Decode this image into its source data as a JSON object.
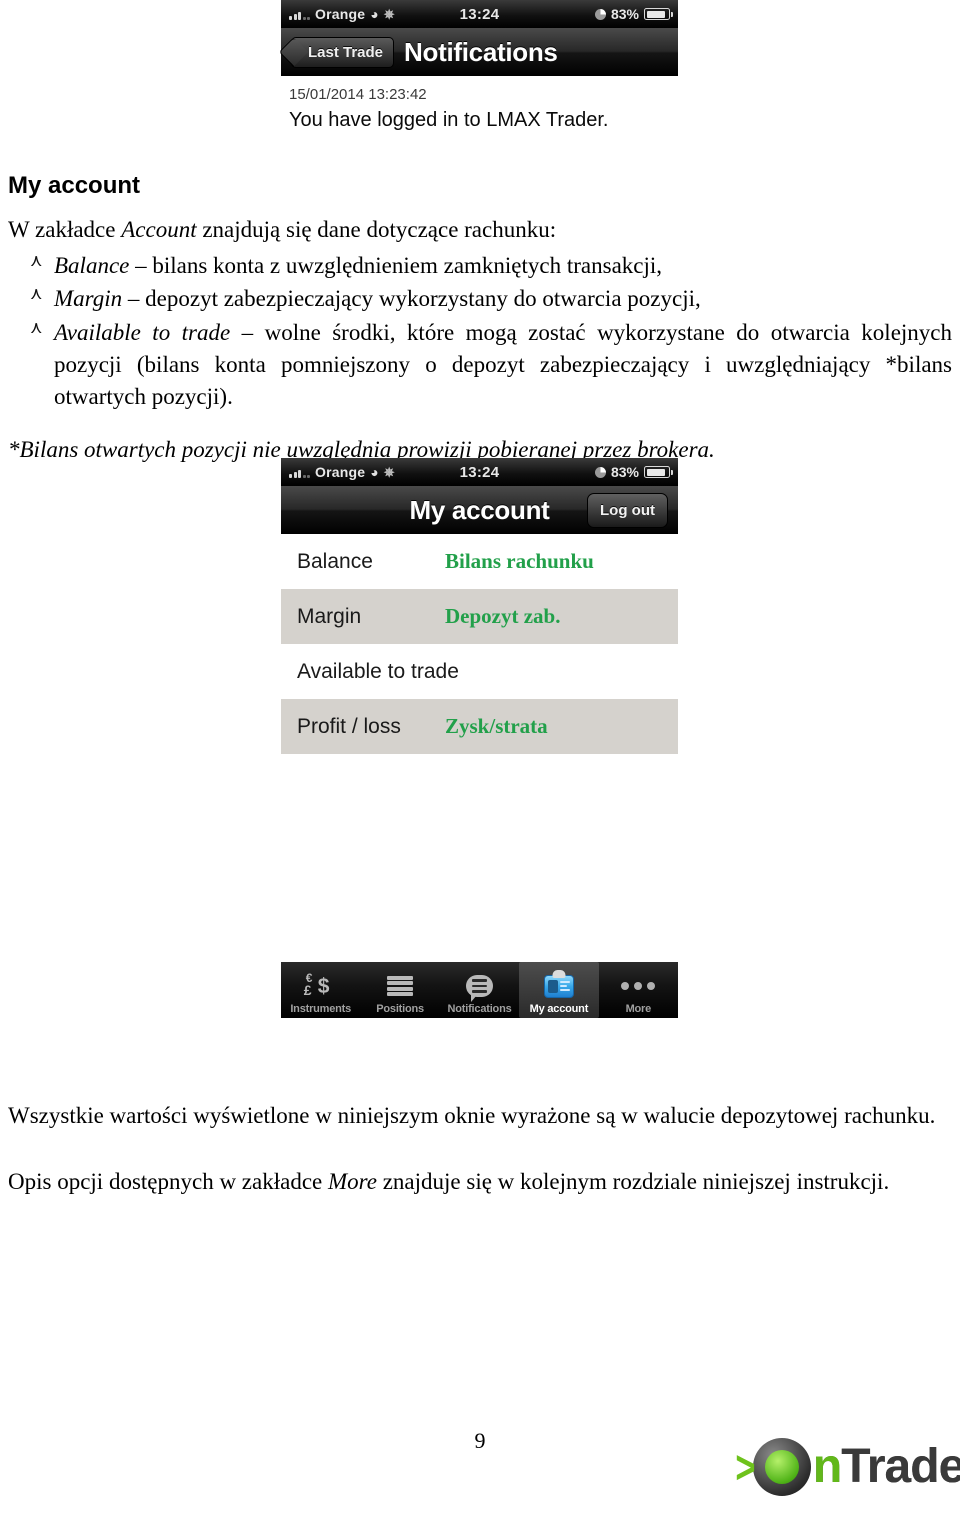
{
  "page": {
    "number": "9"
  },
  "screenshot_notifications": {
    "status_bar": {
      "signal_icon": "signal-bars-icon",
      "carrier": "Orange",
      "wifi_icon": "wifi-icon",
      "activity_icon": "activity-spinner-icon",
      "time": "13:24",
      "alarm_icon": "clock-icon",
      "battery_percent": "83%",
      "battery_icon": "battery-icon"
    },
    "nav": {
      "back_label": "Last Trade",
      "title": "Notifications"
    },
    "notification": {
      "timestamp": "15/01/2014 13:23:42",
      "message": "You have logged in to LMAX Trader."
    }
  },
  "document": {
    "heading": "My account",
    "intro_prefix": "W zakładce ",
    "intro_italic": "Account",
    "intro_suffix": " znajdują się dane dotyczące rachunku:",
    "bullets": [
      {
        "term": "Balance",
        "text": " – bilans konta z uwzględnieniem zamkniętych transakcji,"
      },
      {
        "term": "Margin",
        "text": " – depozyt zabezpieczający wykorzystany do otwarcia pozycji,"
      },
      {
        "term": "Available to trade",
        "text": " – wolne środki, które mogą zostać wykorzystane do otwarcia kolejnych pozycji (bilans konta pomniejszony o depozyt zabezpieczający i uwzględniający *bilans otwartych pozycji)."
      }
    ],
    "footnote": "*Bilans otwartych pozycji nie uwzględnia prowizji pobieranej przez brokera.",
    "closing_paragraph": "Wszystkie wartości wyświetlone w niniejszym oknie wyrażone są w walucie depozytowej rachunku.",
    "more_prefix": "Opis opcji dostępnych w zakładce ",
    "more_italic": "More",
    "more_suffix": " znajduje się w kolejnym rozdziale niniejszej instrukcji."
  },
  "screenshot_account": {
    "status_bar": {
      "signal_icon": "signal-bars-icon",
      "carrier": "Orange",
      "wifi_icon": "wifi-icon",
      "activity_icon": "activity-spinner-icon",
      "time": "13:24",
      "alarm_icon": "clock-icon",
      "battery_percent": "83%",
      "battery_icon": "battery-icon"
    },
    "nav": {
      "title": "My account",
      "logout_label": "Log out"
    },
    "rows": [
      {
        "label": "Balance",
        "annotation": "Bilans rachunku",
        "shaded": false
      },
      {
        "label": "Margin",
        "annotation": "Depozyt zab.",
        "shaded": true
      },
      {
        "label": "Available to trade",
        "annotation": "",
        "shaded": false
      },
      {
        "label": "Profit / loss",
        "annotation": "Zysk/strata",
        "shaded": true
      }
    ],
    "tabs": [
      {
        "label": "Instruments",
        "icon": "currency-symbols-icon",
        "selected": false
      },
      {
        "label": "Positions",
        "icon": "list-icon",
        "selected": false
      },
      {
        "label": "Notifications",
        "icon": "speech-bubble-icon",
        "selected": false
      },
      {
        "label": "My account",
        "icon": "id-card-icon",
        "selected": true
      },
      {
        "label": "More",
        "icon": "ellipsis-dots-icon",
        "selected": false
      }
    ]
  },
  "footer_logo": {
    "chevron_icon": "green-chevron-icon",
    "ring_icon": "green-o-ring-icon",
    "text_n": "n",
    "text_rest": "Trade"
  },
  "colors": {
    "annotation_green": "#22a04a",
    "logo_green": "#62b81a",
    "row_shade": "#d5d2cd"
  }
}
